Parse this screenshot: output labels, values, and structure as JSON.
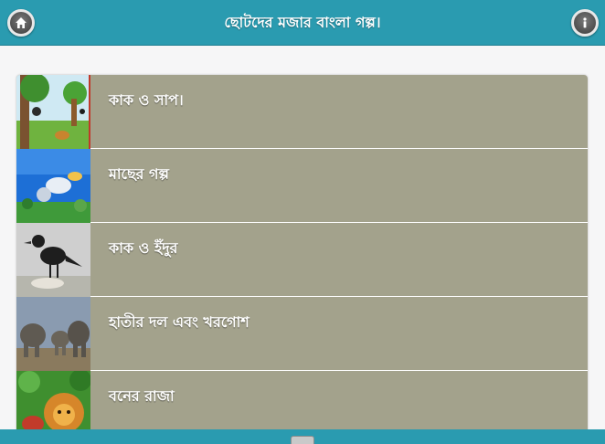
{
  "header": {
    "title": "ছোটদের মজার বাংলা গল্প।",
    "home_icon": "home-icon",
    "info_icon": "info-icon"
  },
  "stories": [
    {
      "label": "কাক ও সাপ।",
      "thumb": "jungle-tree-scene"
    },
    {
      "label": "মাছের গল্প",
      "thumb": "underwater-fish-scene"
    },
    {
      "label": "কাক ও ইঁদুর",
      "thumb": "crow-on-ground"
    },
    {
      "label": "হাতীর দল এবং খরগোশ",
      "thumb": "elephant-herd"
    },
    {
      "label": "বনের রাজা",
      "thumb": "lion-in-forest"
    }
  ],
  "colors": {
    "header": "#2a9bb0",
    "row": "#a3a28c",
    "background": "#f6f6f7"
  }
}
